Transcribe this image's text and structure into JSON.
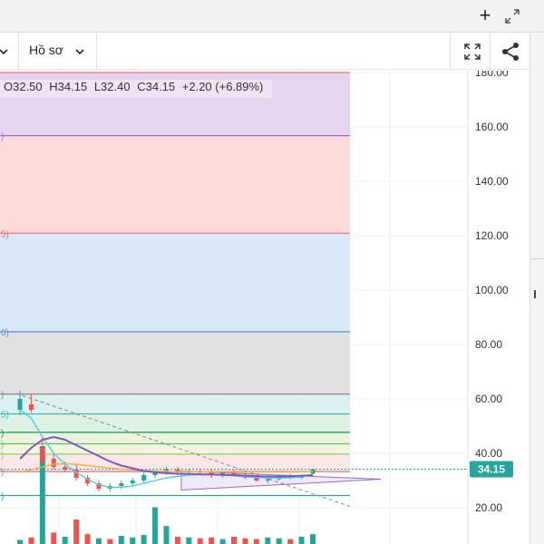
{
  "window": {
    "add_icon": "plus-icon",
    "expand_icon": "expand-icon"
  },
  "toolbar": {
    "profile_label": "Hồ sơ",
    "fullscreen_icon": "fullscreen-icon",
    "share_icon": "share-icon"
  },
  "ohlc": {
    "open": "O32.50",
    "high": "H34.15",
    "low": "L32.40",
    "close": "C34.15",
    "change": "+2.20 (+6.89%)"
  },
  "price_badge": "34.15",
  "colors": {
    "up": "#26a69a",
    "down": "#ef5350",
    "ma_purple": "#7e57c2",
    "ma_cyan": "#4dd0e1",
    "ma_orange": "#f5b041",
    "badge": "#26a69a"
  },
  "chart_data": {
    "type": "candlestick",
    "y_axis": {
      "min": 20,
      "max": 180,
      "ticks": [
        "20.00",
        "40.00",
        "60.00",
        "80.00",
        "100.00",
        "120.00",
        "140.00",
        "160.00",
        "180.00"
      ]
    },
    "last_price": 34.15,
    "fib_levels": [
      {
        "price": 180,
        "fill": "#f8c9d4",
        "line": "#e57373",
        "edge_label": ""
      },
      {
        "price": 156.8,
        "fill": "#e2cdee",
        "line": "#9c6ac7",
        "edge_label": ")"
      },
      {
        "price": 120.9,
        "fill": "#fbd5d5",
        "line": "#e57373",
        "edge_label": "5)"
      },
      {
        "price": 84.7,
        "fill": "#d3e5f8",
        "line": "#5b8fd6",
        "edge_label": "0)"
      },
      {
        "price": 61.8,
        "fill": "#dcdcdc",
        "line": "#888888",
        "edge_label": ")"
      },
      {
        "price": 54.5,
        "fill": "#d6edf0",
        "line": "#4db6ac",
        "edge_label": "5)"
      },
      {
        "price": 47.7,
        "fill": "#d8efe0",
        "line": "#2e8b57",
        "edge_label": ")"
      },
      {
        "price": 43.5,
        "fill": "#e7f3d8",
        "line": "#66bb6a",
        "edge_label": ")"
      },
      {
        "price": 39.7,
        "fill": "#f0f5dc",
        "line": "#9ccc65",
        "edge_label": ")"
      },
      {
        "price": 33.3,
        "fill": "#fbe3e3",
        "line": "#e57373",
        "edge_label": ")"
      },
      {
        "price": 24.5,
        "fill": "#ffffff",
        "line": "#26a69a",
        "edge_label": ")"
      }
    ],
    "candles": [
      {
        "o": 56,
        "h": 63,
        "l": 54,
        "c": 60
      },
      {
        "o": 58,
        "h": 62,
        "l": 55,
        "c": 56
      },
      {
        "o": 42,
        "h": 46,
        "l": 36,
        "c": 37
      },
      {
        "o": 38,
        "h": 40,
        "l": 34,
        "c": 35
      },
      {
        "o": 35,
        "h": 37,
        "l": 33,
        "c": 34
      },
      {
        "o": 34,
        "h": 36,
        "l": 30,
        "c": 31
      },
      {
        "o": 31,
        "h": 32,
        "l": 28,
        "c": 29
      },
      {
        "o": 29,
        "h": 30,
        "l": 26,
        "c": 27
      },
      {
        "o": 27,
        "h": 29,
        "l": 26,
        "c": 28
      },
      {
        "o": 28,
        "h": 30,
        "l": 27,
        "c": 29
      },
      {
        "o": 29,
        "h": 31,
        "l": 28,
        "c": 30
      },
      {
        "o": 30,
        "h": 33,
        "l": 29,
        "c": 32
      },
      {
        "o": 32,
        "h": 34,
        "l": 31,
        "c": 33
      },
      {
        "o": 33,
        "h": 35,
        "l": 32,
        "c": 34
      },
      {
        "o": 34,
        "h": 35,
        "l": 32,
        "c": 33
      },
      {
        "o": 33,
        "h": 34,
        "l": 32,
        "c": 33.5
      },
      {
        "o": 33.5,
        "h": 34.5,
        "l": 32.5,
        "c": 33
      },
      {
        "o": 33,
        "h": 34,
        "l": 31,
        "c": 32
      },
      {
        "o": 32,
        "h": 33.5,
        "l": 31,
        "c": 33
      },
      {
        "o": 33,
        "h": 34,
        "l": 31.5,
        "c": 32
      },
      {
        "o": 32,
        "h": 33,
        "l": 30.5,
        "c": 31
      },
      {
        "o": 31,
        "h": 32,
        "l": 29.5,
        "c": 30
      },
      {
        "o": 30,
        "h": 31,
        "l": 29,
        "c": 30.5
      },
      {
        "o": 30.5,
        "h": 32,
        "l": 30,
        "c": 31.5
      },
      {
        "o": 31.5,
        "h": 32.5,
        "l": 30.5,
        "c": 31
      },
      {
        "o": 31,
        "h": 32,
        "l": 30.5,
        "c": 31.8
      },
      {
        "o": 32.5,
        "h": 34.15,
        "l": 32.4,
        "c": 34.15
      }
    ],
    "ma_purple": [
      38,
      42,
      45,
      46,
      45,
      43,
      41,
      39,
      37,
      35.5,
      34.5,
      33.5,
      33,
      32.7,
      32.5,
      32.4,
      32.3,
      32.2,
      32.1,
      32,
      31.8,
      31.6,
      31.5,
      31.5,
      31.6,
      31.8,
      32
    ],
    "ma_cyan": [
      56,
      53,
      46,
      40,
      36,
      33,
      30.5,
      28.5,
      27.5,
      27.5,
      28,
      29,
      30,
      31,
      31.5,
      32,
      32.2,
      32.2,
      32,
      31.7,
      31.4,
      31.1,
      30.9,
      30.9,
      31,
      31.3,
      32
    ],
    "ma_orange": [
      33,
      34,
      35,
      36,
      36.2,
      36,
      35.5,
      35,
      34.6,
      34.2,
      33.9,
      33.7,
      33.5,
      33.4,
      33.3,
      33.3,
      33.3,
      33.2,
      33.2,
      33.1,
      33.1,
      33.1,
      33.1,
      33.1,
      33.1,
      33.2,
      33.3
    ],
    "volumes": [
      5,
      8,
      120,
      14,
      9,
      30,
      12,
      7,
      6,
      10,
      8,
      11,
      45,
      22,
      9,
      8,
      7,
      8,
      6,
      9,
      7,
      6,
      8,
      7,
      6,
      9,
      12
    ],
    "volume_up": [
      true,
      false,
      true,
      false,
      true,
      false,
      false,
      true,
      false,
      true,
      true,
      true,
      true,
      true,
      false,
      true,
      false,
      false,
      true,
      false,
      false,
      false,
      true,
      true,
      false,
      true,
      true
    ]
  }
}
